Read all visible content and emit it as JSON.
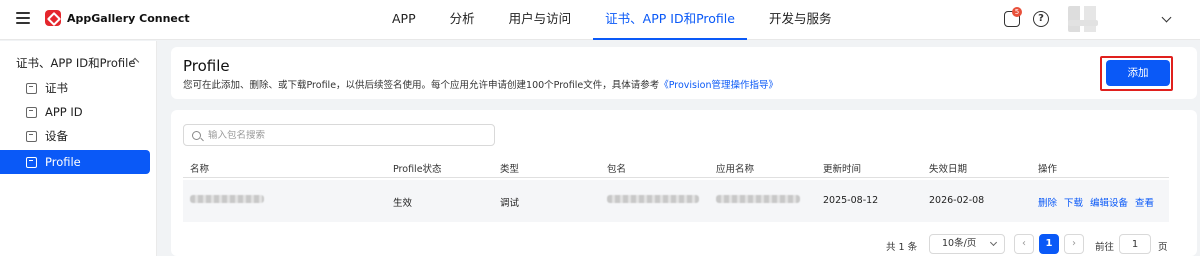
{
  "brand": {
    "name": "AppGallery Connect"
  },
  "nav": {
    "items": [
      {
        "label": "APP"
      },
      {
        "label": "分析"
      },
      {
        "label": "用户与访问"
      },
      {
        "label": "证书、APP ID和Profile"
      },
      {
        "label": "开发与服务"
      }
    ],
    "active_index": 3
  },
  "topbar": {
    "notification_count": "5",
    "help_symbol": "?"
  },
  "sidebar": {
    "group_label": "证书、APP ID和Profile",
    "items": [
      {
        "label": "证书",
        "icon": "certificate-icon"
      },
      {
        "label": "APP ID",
        "icon": "app-id-icon"
      },
      {
        "label": "设备",
        "icon": "device-icon"
      },
      {
        "label": "Profile",
        "icon": "profile-icon"
      }
    ],
    "active_index": 3
  },
  "header": {
    "title": "Profile",
    "description": "您可在此添加、删除、或下载Profile，以供后续签名使用。每个应用允许申请创建100个Profile文件，具体请参考",
    "guide_link": "《Provision管理操作指导》",
    "add_button": "添加"
  },
  "table": {
    "search_placeholder": "输入包名搜索",
    "columns": [
      "名称",
      "Profile状态",
      "类型",
      "包名",
      "应用名称",
      "更新时间",
      "失效日期",
      "操作"
    ],
    "rows": [
      {
        "status": "生效",
        "type": "调试",
        "updated": "2025-08-12",
        "expires": "2026-02-08",
        "actions": [
          "删除",
          "下载",
          "编辑设备",
          "查看"
        ]
      }
    ]
  },
  "pagination": {
    "total": "共 1 条",
    "page_size": "10条/页",
    "prev": "‹",
    "current_page": "1",
    "next": "›",
    "goto_label": "前往",
    "goto_value": "1",
    "goto_suffix": "页"
  },
  "colors": {
    "accent": "#0a59f7",
    "highlight": "#e0201d",
    "brand_red": "#e4262c"
  }
}
